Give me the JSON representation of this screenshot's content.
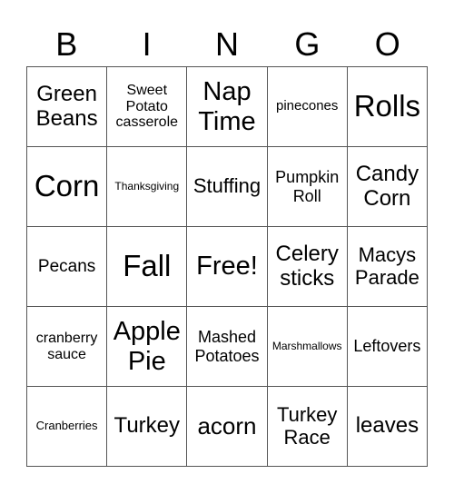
{
  "header": {
    "letters": [
      "B",
      "I",
      "N",
      "G",
      "O"
    ]
  },
  "cells": [
    [
      "Green Beans",
      "Sweet Potato casserole",
      "Nap Time",
      "pinecones",
      "Rolls"
    ],
    [
      "Corn",
      "Thanksgiving",
      "Stuffing",
      "Pumpkin Roll",
      "Candy Corn"
    ],
    [
      "Pecans",
      "Fall",
      "Free!",
      "Celery sticks",
      "Macys Parade"
    ],
    [
      "cranberry sauce",
      "Apple Pie",
      "Mashed Potatoes",
      "Marshmallows",
      "Leftovers"
    ],
    [
      "Cranberries",
      "Turkey",
      "acorn",
      "Turkey Race",
      "leaves"
    ]
  ]
}
